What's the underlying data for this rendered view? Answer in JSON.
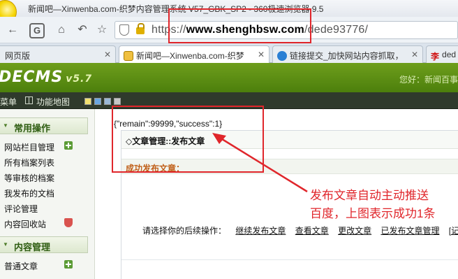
{
  "browser": {
    "title": "新闻吧—Xinwenba.com-织梦内容管理系统 V57_GBK_SP2 - 360极速浏览器 9.5",
    "url_prefix": "https://",
    "url_host": "www.shenghbsw.com",
    "url_path": "/dede93776/"
  },
  "tabs": [
    {
      "label": "网页版"
    },
    {
      "label": "新闻吧—Xinwenba.com-织梦"
    },
    {
      "label": "链接提交_加快网站内容抓取，"
    },
    {
      "label": "ded"
    }
  ],
  "header": {
    "brand": "DECMS",
    "version": "v5.7",
    "welcome": "您好：新闻百事"
  },
  "menubar": {
    "menu_label": "菜单",
    "map_label": "功能地图"
  },
  "sidebar": {
    "section1": "常用操作",
    "items1": [
      "网站栏目管理",
      "所有档案列表",
      "等审核的档案",
      "我发布的文档",
      "评论管理",
      "内容回收站"
    ],
    "section2": "内容管理",
    "items2": [
      "普通文章"
    ]
  },
  "content": {
    "json_result": "{\"remain\":99999,\"success\":1}",
    "panel_title": "◇文章管理::发布文章",
    "success_label": "成功发布文章：",
    "ops_prompt": "请选择你的后续操作：",
    "ops": [
      "继续发布文章",
      "查看文章",
      "更改文章",
      "已发布文章管理",
      "[记"
    ]
  },
  "annotation": {
    "line1": "发布文章自动主动推送",
    "line2": "百度，上图表示成功1条",
    "color": "#e0262b"
  }
}
